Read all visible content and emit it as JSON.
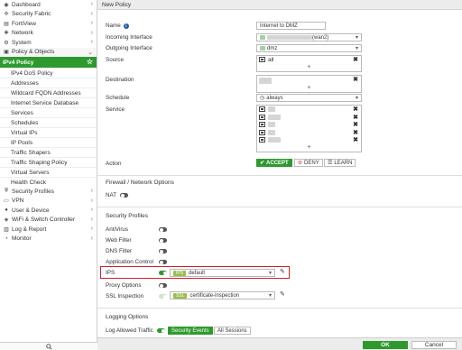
{
  "sidebar": {
    "items": [
      {
        "label": "Dashboard",
        "icon": "dashboard-icon",
        "glyph": "◉"
      },
      {
        "label": "Security Fabric",
        "icon": "fabric-icon",
        "glyph": "✣"
      },
      {
        "label": "FortiView",
        "icon": "fortiview-icon",
        "glyph": "▤"
      },
      {
        "label": "Network",
        "icon": "network-icon",
        "glyph": "✚"
      },
      {
        "label": "System",
        "icon": "gear-icon",
        "glyph": "⚙"
      },
      {
        "label": "Policy & Objects",
        "icon": "policy-icon",
        "glyph": "▣"
      }
    ],
    "active_label": "IPv4 Policy",
    "subitems": [
      "IPv4 DoS Policy",
      "Addresses",
      "Wildcard FQDN Addresses",
      "Internet Service Database",
      "Services",
      "Schedules",
      "Virtual IPs",
      "IP Pools",
      "Traffic Shapers",
      "Traffic Shaping Policy",
      "Virtual Servers",
      "Health Check"
    ],
    "items_bottom": [
      {
        "label": "Security Profiles",
        "icon": "shield-icon",
        "glyph": "⛨"
      },
      {
        "label": "VPN",
        "icon": "vpn-icon",
        "glyph": "▭"
      },
      {
        "label": "User & Device",
        "icon": "user-icon",
        "glyph": "●"
      },
      {
        "label": "WiFi & Switch Controller",
        "icon": "wifi-icon",
        "glyph": "◈"
      },
      {
        "label": "Log & Report",
        "icon": "log-icon",
        "glyph": "▥"
      },
      {
        "label": "Monitor",
        "icon": "monitor-icon",
        "glyph": "◔"
      }
    ],
    "search_icon": "search-icon"
  },
  "header": {
    "title": "New Policy"
  },
  "form": {
    "name_label": "Name",
    "name_value": "Internet to DMZ",
    "incoming_label": "Incoming Interface",
    "incoming_value": "(wan2)",
    "outgoing_label": "Outgoing Interface",
    "outgoing_value": "dmz",
    "source_label": "Source",
    "source_value": "all",
    "destination_label": "Destination",
    "schedule_label": "Schedule",
    "schedule_value": "always",
    "service_label": "Service",
    "action_label": "Action",
    "action_accept": "ACCEPT",
    "action_deny": "DENY",
    "action_learn": "LEARN",
    "plus": "+"
  },
  "firewall": {
    "title": "Firewall / Network Options",
    "nat_label": "NAT"
  },
  "security_profiles": {
    "title": "Security Profiles",
    "antivirus": "AntiVirus",
    "web_filter": "Web Filter",
    "dns_filter": "DNS Filter",
    "app_control": "Application Control",
    "ips": "IPS",
    "ips_badge": "IPS",
    "ips_value": "default",
    "proxy_options": "Proxy Options",
    "ssl_inspection": "SSL Inspection",
    "ssl_badge": "SSL",
    "ssl_value": "certificate-inspection"
  },
  "logging": {
    "title": "Logging Options",
    "log_label": "Log Allowed Traffic",
    "seg_security": "Security Events",
    "seg_all": "All Sessions"
  },
  "footer": {
    "ok": "OK",
    "cancel": "Cancel"
  },
  "colors": {
    "accent": "#2e9a2e",
    "highlight": "#d0202a"
  }
}
